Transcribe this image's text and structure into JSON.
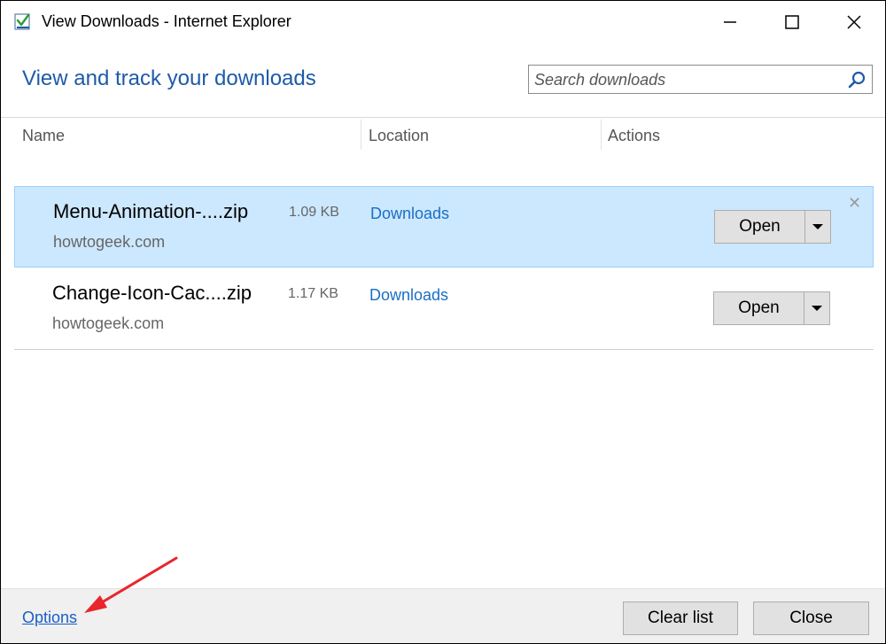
{
  "window": {
    "title": "View Downloads - Internet Explorer"
  },
  "header": {
    "heading": "View and track your downloads",
    "search_placeholder": "Search downloads"
  },
  "columns": {
    "name": "Name",
    "location": "Location",
    "actions": "Actions"
  },
  "downloads": [
    {
      "name": "Menu-Animation-....zip",
      "size": "1.09 KB",
      "source": "howtogeek.com",
      "location": "Downloads",
      "action_label": "Open",
      "selected": true
    },
    {
      "name": "Change-Icon-Cac....zip",
      "size": "1.17 KB",
      "source": "howtogeek.com",
      "location": "Downloads",
      "action_label": "Open",
      "selected": false
    }
  ],
  "footer": {
    "options_label": "Options",
    "clear_list_label": "Clear list",
    "close_label": "Close"
  },
  "colors": {
    "heading": "#1e5aa8",
    "link": "#1a6fc4",
    "selected_row": "#cce8ff",
    "annotation_arrow": "#e8262c"
  },
  "icons": {
    "app": "downloads-app-icon",
    "minimize": "minimize-icon",
    "maximize": "maximize-icon",
    "close": "close-icon",
    "search": "search-icon",
    "remove": "remove-item-icon",
    "dropdown": "dropdown-arrow-icon"
  }
}
